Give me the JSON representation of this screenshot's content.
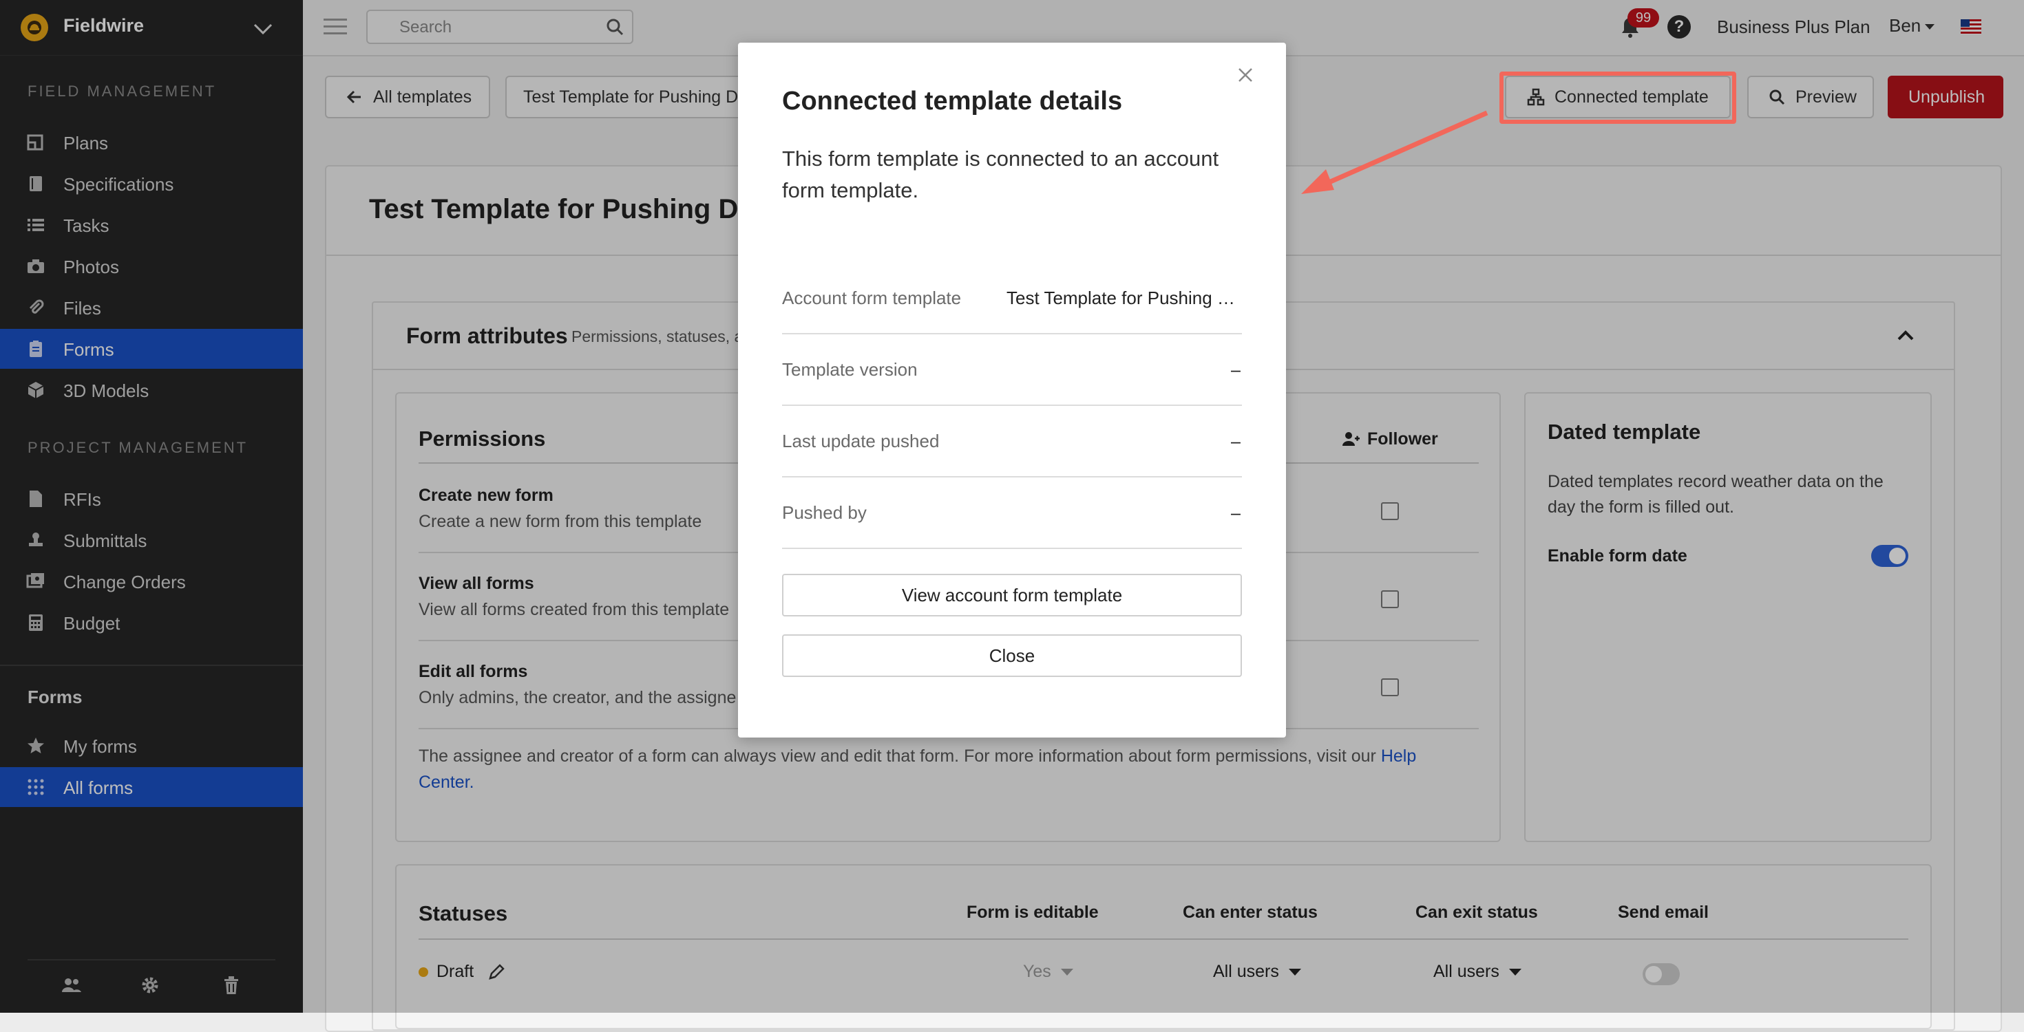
{
  "app": {
    "name": "Fieldwire"
  },
  "sidebar": {
    "field_management_label": "FIELD MANAGEMENT",
    "project_management_label": "PROJECT MANAGEMENT",
    "field_items": [
      {
        "label": "Plans"
      },
      {
        "label": "Specifications"
      },
      {
        "label": "Tasks"
      },
      {
        "label": "Photos"
      },
      {
        "label": "Files"
      },
      {
        "label": "Forms"
      },
      {
        "label": "3D Models"
      }
    ],
    "project_items": [
      {
        "label": "RFIs"
      },
      {
        "label": "Submittals"
      },
      {
        "label": "Change Orders"
      },
      {
        "label": "Budget"
      }
    ],
    "forms_header": "Forms",
    "forms_items": [
      {
        "label": "My forms"
      },
      {
        "label": "All forms"
      }
    ]
  },
  "topbar": {
    "search_placeholder": "Search",
    "notification_count": "99",
    "help_label": "?",
    "plan": "Business Plus Plan",
    "user": "Ben"
  },
  "toolbar": {
    "back_label": "All templates",
    "template_name": "Test Template for Pushing D",
    "connected_label": "Connected template",
    "preview_label": "Preview",
    "unpublish_label": "Unpublish"
  },
  "page": {
    "title": "Test Template for Pushing Dat",
    "form_attributes": {
      "title": "Form attributes",
      "subtitle": "Permissions, statuses, a"
    },
    "permissions": {
      "title": "Permissions",
      "follower_label": "Follower",
      "rows": [
        {
          "title": "Create new form",
          "desc": "Create a new form from this template"
        },
        {
          "title": "View all forms",
          "desc": "View all forms created from this template"
        },
        {
          "title": "Edit all forms",
          "desc": "Only admins, the creator, and the assigne"
        }
      ],
      "note_line1": "The assignee and creator of a form can always view and edit that form. For more information about form permissions, visit our ",
      "note_link1": "Help",
      "note_link2": "Center."
    },
    "dated": {
      "title": "Dated template",
      "desc": "Dated templates record weather data on the day the form is filled out.",
      "enable_label": "Enable form date"
    },
    "statuses": {
      "title": "Statuses",
      "cols": [
        "Form is editable",
        "Can enter status",
        "Can exit status",
        "Send email"
      ],
      "rows": [
        {
          "name": "Draft",
          "editable": "Yes",
          "enter": "All users",
          "exit": "All users"
        }
      ]
    }
  },
  "modal": {
    "title": "Connected template details",
    "desc": "This form template is connected to an account form template.",
    "rows": [
      {
        "key": "Account form template",
        "value": "Test Template for Pushing Data"
      },
      {
        "key": "Template version",
        "value": "–"
      },
      {
        "key": "Last update pushed",
        "value": "–"
      },
      {
        "key": "Pushed by",
        "value": "–"
      }
    ],
    "view_button": "View account form template",
    "close_button": "Close"
  },
  "colors": {
    "accent": "#1a52c7",
    "danger": "#b6141c",
    "annotation": "#f2675a",
    "sidebar_bg": "#262626"
  }
}
